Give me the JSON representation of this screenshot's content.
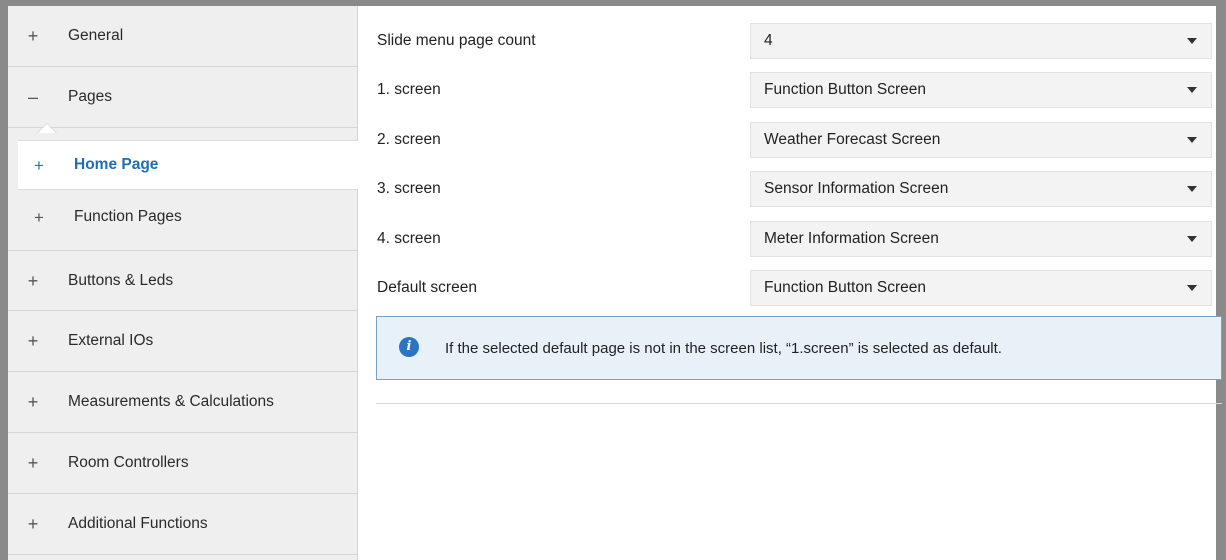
{
  "sidebar": {
    "items": [
      {
        "sign": "+",
        "label": "General"
      },
      {
        "sign": "–",
        "label": "Pages"
      },
      {
        "sign": "+",
        "label": "Buttons & Leds"
      },
      {
        "sign": "+",
        "label": "External IOs"
      },
      {
        "sign": "+",
        "label": "Measurements & Calculations"
      },
      {
        "sign": "+",
        "label": "Room Controllers"
      },
      {
        "sign": "+",
        "label": "Additional Functions"
      }
    ],
    "sub_items": [
      {
        "sign": "+",
        "label": "Home Page"
      },
      {
        "sign": "+",
        "label": "Function Pages"
      }
    ]
  },
  "form": {
    "rows": [
      {
        "label": "Slide menu page count",
        "value": "4"
      },
      {
        "label": "1. screen",
        "value": "Function Button Screen"
      },
      {
        "label": "2. screen",
        "value": "Weather Forecast Screen"
      },
      {
        "label": "3. screen",
        "value": "Sensor Information Screen"
      },
      {
        "label": "4. screen",
        "value": "Meter Information Screen"
      },
      {
        "label": "Default screen",
        "value": "Function Button Screen"
      }
    ],
    "info": {
      "icon": "i",
      "text": "If the selected default page is not in the screen list, “1.screen” is selected as default."
    }
  },
  "colors": {
    "accent": "#1e6fb3",
    "sidebar_bg": "#efefef",
    "info_bg": "#e8f0f8",
    "info_border": "#7aa2c6"
  }
}
